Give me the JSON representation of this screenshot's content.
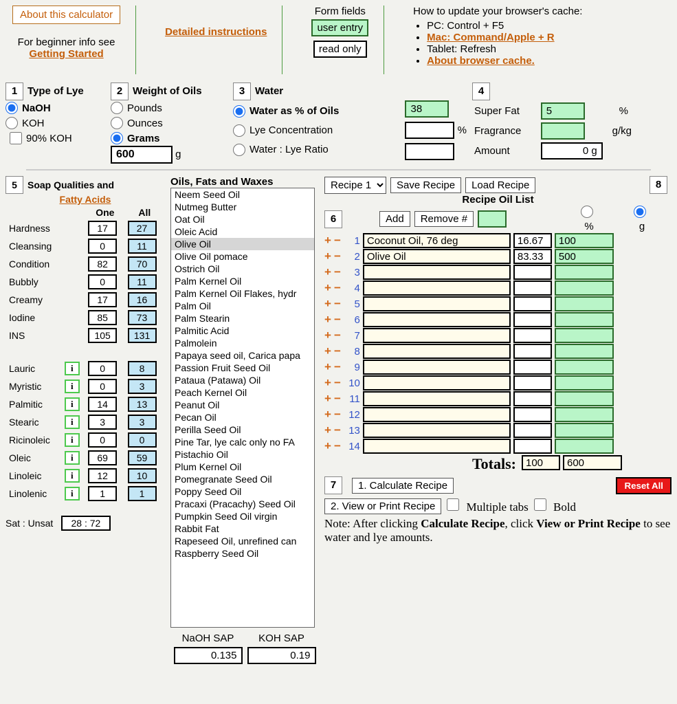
{
  "header": {
    "about_btn": "About this calculator",
    "beginner_text": "For beginner info see",
    "getting_started": "Getting Started",
    "detailed": "Detailed instructions",
    "form_fields": "Form fields",
    "user_entry": "user entry",
    "read_only": "read only",
    "cache_title": "How to update your browser's cache:",
    "cache_items": [
      "PC: Control + F5",
      "Mac: Command/Apple + R",
      "Tablet: Refresh",
      "About browser cache."
    ]
  },
  "sec1": {
    "title": "Type of Lye",
    "opts": [
      "NaOH",
      "KOH",
      "90% KOH"
    ]
  },
  "sec2": {
    "title": "Weight of Oils",
    "opts": [
      "Pounds",
      "Ounces",
      "Grams"
    ],
    "value": "600",
    "unit": "g"
  },
  "sec3": {
    "title": "Water",
    "opts": [
      "Water as % of Oils",
      "Lye Concentration",
      "Water : Lye Ratio"
    ],
    "val": "38",
    "pct": "%"
  },
  "sec4": {
    "superfat": "Super Fat",
    "sf_val": "5",
    "pct": "%",
    "fragrance": "Fragrance",
    "fr_unit": "g/kg",
    "amount": "Amount",
    "amount_val": "0 g"
  },
  "sec5": {
    "title": "Soap Qualities and",
    "link": "Fatty Acids",
    "col_one": "One",
    "col_all": "All",
    "qualities": [
      {
        "label": "Hardness",
        "one": "17",
        "all": "27"
      },
      {
        "label": "Cleansing",
        "one": "0",
        "all": "11"
      },
      {
        "label": "Condition",
        "one": "82",
        "all": "70"
      },
      {
        "label": "Bubbly",
        "one": "0",
        "all": "11"
      },
      {
        "label": "Creamy",
        "one": "17",
        "all": "16"
      },
      {
        "label": "Iodine",
        "one": "85",
        "all": "73"
      },
      {
        "label": "INS",
        "one": "105",
        "all": "131"
      }
    ],
    "fatty": [
      {
        "label": "Lauric",
        "one": "0",
        "all": "8"
      },
      {
        "label": "Myristic",
        "one": "0",
        "all": "3"
      },
      {
        "label": "Palmitic",
        "one": "14",
        "all": "13"
      },
      {
        "label": "Stearic",
        "one": "3",
        "all": "3"
      },
      {
        "label": "Ricinoleic",
        "one": "0",
        "all": "0"
      },
      {
        "label": "Oleic",
        "one": "69",
        "all": "59"
      },
      {
        "label": "Linoleic",
        "one": "12",
        "all": "10"
      },
      {
        "label": "Linolenic",
        "one": "1",
        "all": "1"
      }
    ],
    "sat_label": "Sat : Unsat",
    "sat_val": "28 : 72"
  },
  "oils": {
    "title": "Oils, Fats and Waxes",
    "list": [
      "Neem Seed Oil",
      "Nutmeg Butter",
      "Oat Oil",
      "Oleic Acid",
      "Olive Oil",
      "Olive Oil pomace",
      "Ostrich Oil",
      "Palm Kernel Oil",
      "Palm Kernel Oil Flakes, hydr",
      "Palm Oil",
      "Palm Stearin",
      "Palmitic Acid",
      "Palmolein",
      "Papaya seed oil, Carica papa",
      "Passion Fruit Seed Oil",
      "Pataua (Patawa) Oil",
      "Peach Kernel Oil",
      "Peanut Oil",
      "Pecan Oil",
      "Perilla Seed Oil",
      "Pine Tar, lye calc only no FA",
      "Pistachio Oil",
      "Plum Kernel Oil",
      "Pomegranate Seed Oil",
      "Poppy Seed Oil",
      "Pracaxi (Pracachy) Seed Oil",
      "Pumpkin Seed Oil virgin",
      "Rabbit Fat",
      "Rapeseed Oil, unrefined can",
      "Raspberry Seed Oil"
    ],
    "selected_index": 4,
    "sap_naoh_label": "NaOH SAP",
    "sap_koh_label": "KOH SAP",
    "sap_naoh": "0.135",
    "sap_koh": "0.19"
  },
  "recipe": {
    "select": "Recipe 1",
    "save": "Save Recipe",
    "load": "Load Recipe",
    "title": "Recipe Oil List",
    "add": "Add",
    "remove": "Remove #",
    "col_pct": "%",
    "col_g": "g",
    "rows": [
      {
        "n": "1",
        "name": "Coconut Oil, 76 deg",
        "pct": "16.67",
        "g": "100"
      },
      {
        "n": "2",
        "name": "Olive Oil",
        "pct": "83.33",
        "g": "500"
      },
      {
        "n": "3",
        "name": "",
        "pct": "",
        "g": ""
      },
      {
        "n": "4",
        "name": "",
        "pct": "",
        "g": ""
      },
      {
        "n": "5",
        "name": "",
        "pct": "",
        "g": ""
      },
      {
        "n": "6",
        "name": "",
        "pct": "",
        "g": ""
      },
      {
        "n": "7",
        "name": "",
        "pct": "",
        "g": ""
      },
      {
        "n": "8",
        "name": "",
        "pct": "",
        "g": ""
      },
      {
        "n": "9",
        "name": "",
        "pct": "",
        "g": ""
      },
      {
        "n": "10",
        "name": "",
        "pct": "",
        "g": ""
      },
      {
        "n": "11",
        "name": "",
        "pct": "",
        "g": ""
      },
      {
        "n": "12",
        "name": "",
        "pct": "",
        "g": ""
      },
      {
        "n": "13",
        "name": "",
        "pct": "",
        "g": ""
      },
      {
        "n": "14",
        "name": "",
        "pct": "",
        "g": ""
      }
    ],
    "totals": "Totals:",
    "tot_pct": "100",
    "tot_g": "600",
    "calc": "1. Calculate Recipe",
    "view": "2. View or Print Recipe",
    "multi": "Multiple tabs",
    "bold": "Bold",
    "reset": "Reset All",
    "note1": "Note: After clicking ",
    "note2": "Calculate Recipe",
    "note3": ", click ",
    "note4": "View or Print Recipe",
    "note5": " to see water and lye amounts."
  }
}
